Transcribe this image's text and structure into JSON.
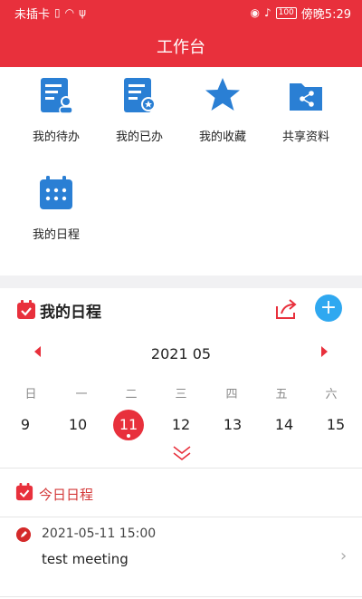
{
  "status_bar": {
    "carrier": "未插卡",
    "battery": "100",
    "time": "傍晚5:29"
  },
  "header": {
    "title": "工作台"
  },
  "tiles": [
    {
      "label": "我的待办",
      "icon": "todo-doc-icon"
    },
    {
      "label": "我的已办",
      "icon": "done-doc-icon"
    },
    {
      "label": "我的收藏",
      "icon": "star-icon"
    },
    {
      "label": "共享资料",
      "icon": "shared-folder-icon"
    },
    {
      "label": "我的日程",
      "icon": "calendar-icon"
    }
  ],
  "schedule": {
    "title": "我的日程",
    "month": "2021 05",
    "weekdays": [
      "日",
      "一",
      "二",
      "三",
      "四",
      "五",
      "六"
    ],
    "days": [
      "9",
      "10",
      "11",
      "12",
      "13",
      "14",
      "15"
    ],
    "selected_day": "11"
  },
  "today": {
    "title": "今日日程",
    "events": [
      {
        "time": "2021-05-11 15:00",
        "title": "test meeting"
      }
    ]
  },
  "colors": {
    "brand_red": "#e8303c",
    "icon_blue": "#2a7fd4",
    "add_button_blue": "#2fa8f0"
  }
}
